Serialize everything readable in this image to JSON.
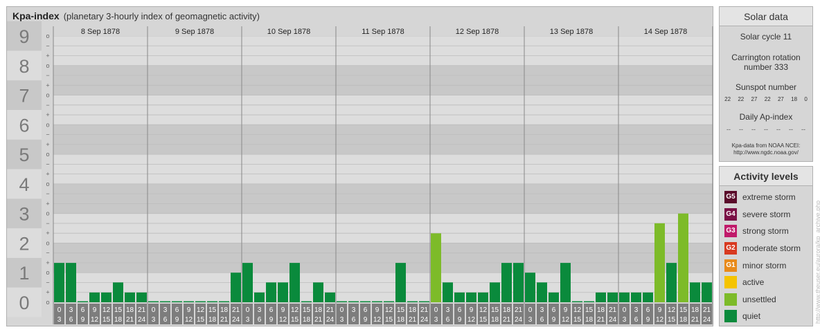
{
  "title": {
    "main": "Kpa-index",
    "sub": "(planetary 3-hourly index of geomagnetic activity)"
  },
  "yaxis": {
    "levels": [
      "0",
      "1",
      "2",
      "3",
      "4",
      "5",
      "6",
      "7",
      "8",
      "9"
    ],
    "subticks": [
      "o",
      "+",
      "−",
      "o"
    ]
  },
  "chart_data": {
    "type": "bar",
    "title": "Kpa-index",
    "ylim": [
      0,
      9
    ],
    "days": [
      "8 Sep 1878",
      "9 Sep 1878",
      "10 Sep 1878",
      "11 Sep 1878",
      "12 Sep 1878",
      "13 Sep 1878",
      "14 Sep 1878"
    ],
    "interval_labels": [
      [
        "0",
        "3"
      ],
      [
        "3",
        "6"
      ],
      [
        "6",
        "9"
      ],
      [
        "9",
        "12"
      ],
      [
        "12",
        "15"
      ],
      [
        "15",
        "18"
      ],
      [
        "18",
        "21"
      ],
      [
        "21",
        "24"
      ]
    ],
    "values": [
      [
        1.33,
        1.33,
        0.0,
        0.33,
        0.33,
        0.67,
        0.33,
        0.33
      ],
      [
        0.0,
        0.0,
        0.0,
        0.0,
        0.0,
        0.0,
        0.0,
        1.0
      ],
      [
        1.33,
        0.33,
        0.67,
        0.67,
        1.33,
        0.0,
        0.67,
        0.33
      ],
      [
        0.0,
        0.0,
        0.0,
        0.0,
        0.0,
        1.33,
        0.0,
        0.0
      ],
      [
        2.33,
        0.67,
        0.33,
        0.33,
        0.33,
        0.67,
        1.33,
        1.33
      ],
      [
        1.0,
        0.67,
        0.33,
        1.33,
        0.0,
        0.0,
        0.33,
        0.33
      ],
      [
        0.33,
        0.33,
        0.33,
        2.67,
        1.33,
        3.0,
        0.67,
        0.67
      ]
    ]
  },
  "colors": {
    "quiet": "#0a8a3c",
    "unsettled": "#7dbb29",
    "panel": "#d6d6d6",
    "band_dark": "#c8c8c8",
    "band_light": "#dddddd"
  },
  "solar": {
    "heading": "Solar data",
    "cycle": "Solar cycle 11",
    "carrington": "Carrington rotation number 333",
    "sunspot_label": "Sunspot number",
    "sunspots": [
      "22",
      "22",
      "27",
      "22",
      "27",
      "18",
      "0"
    ],
    "ap_label": "Daily Ap-index",
    "ap": [
      "--",
      "--",
      "--",
      "--",
      "--",
      "--",
      "--"
    ],
    "note1": "Kpa-data from NOAA NCEI:",
    "note2": "http://www.ngdc.noaa.gov/"
  },
  "activity": {
    "heading": "Activity levels",
    "levels": [
      {
        "code": "G5",
        "label": "extreme storm",
        "color": "#5a0a2a"
      },
      {
        "code": "G4",
        "label": "severe storm",
        "color": "#7a1045"
      },
      {
        "code": "G3",
        "label": "strong storm",
        "color": "#c01a6a"
      },
      {
        "code": "G2",
        "label": "moderate storm",
        "color": "#d83a20"
      },
      {
        "code": "G1",
        "label": "minor storm",
        "color": "#e88a1a"
      },
      {
        "code": "",
        "label": "active",
        "color": "#f5c400"
      },
      {
        "code": "",
        "label": "unsettled",
        "color": "#7dbb29"
      },
      {
        "code": "",
        "label": "quiet",
        "color": "#0a8a3c"
      }
    ]
  },
  "watermark": "http://www.theuser.eu/aurora/kp_archive.php"
}
